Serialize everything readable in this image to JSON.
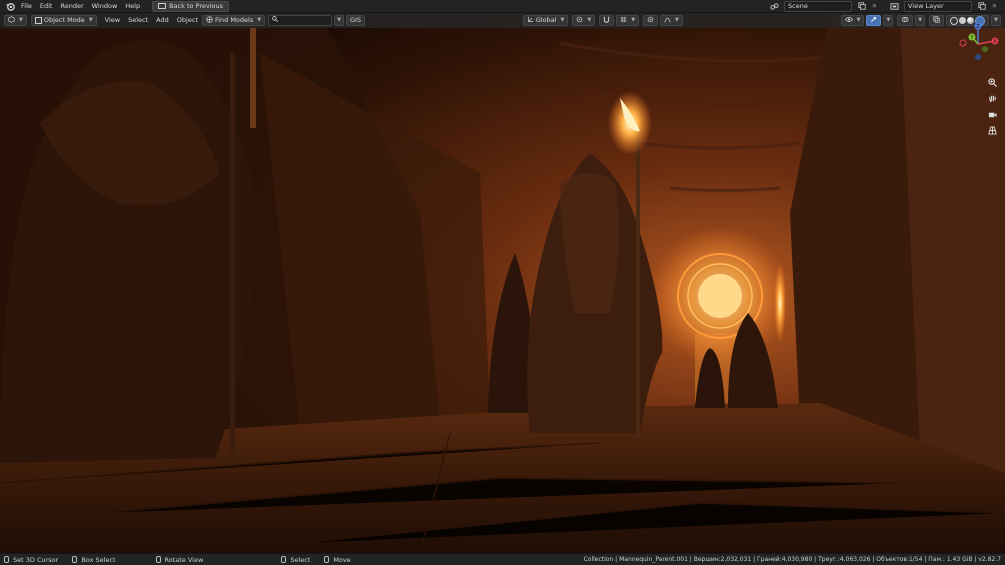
{
  "topbar": {
    "menus": [
      "File",
      "Edit",
      "Render",
      "Window",
      "Help"
    ],
    "back_button": "Back to Previous",
    "scene": "Scene",
    "view_layer": "View Layer"
  },
  "header": {
    "view_menus": [
      "View",
      "Select",
      "Add",
      "Object"
    ],
    "mode": "Object Mode",
    "find_models": "Find Models",
    "search_value": "",
    "gis": "GIS",
    "transform_orientation": "Global"
  },
  "gizmo": {
    "x": "X",
    "y": "Y",
    "z": "Z"
  },
  "statusbar": {
    "set_cursor": "Set 3D Cursor",
    "box_select": "Box Select",
    "rotate_view": "Rotate View",
    "select": "Select",
    "move": "Move",
    "stats": "Collection | Mannequin_Parent.001 | Вершин:2,032,031 | Граней:4,030,980 | Треуг.:4,063,026 | Объектов:1/54 | Пам.: 1.43 GiB | v2.82.7"
  },
  "colors": {
    "accent": "#e6873a",
    "glow": "#ffd27a",
    "bar": "#232323"
  }
}
